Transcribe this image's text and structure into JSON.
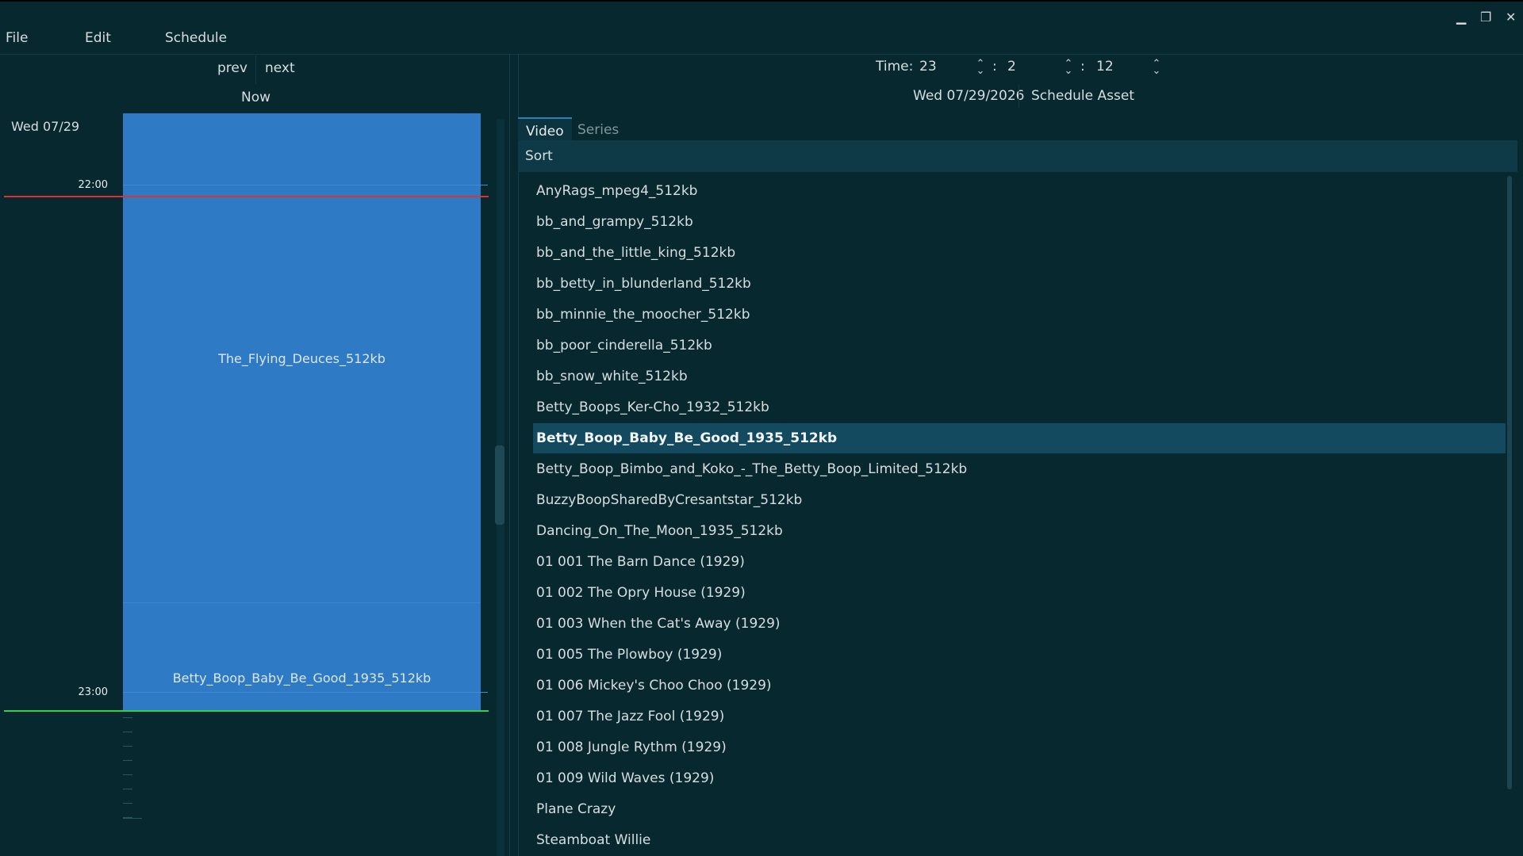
{
  "window": {
    "minimize": "▁",
    "restore": "❐",
    "close": "✕"
  },
  "menu": {
    "file": "File",
    "edit": "Edit",
    "schedule": "Schedule"
  },
  "nav": {
    "prev": "prev",
    "next": "next",
    "now": "Now"
  },
  "calendar": {
    "day_label": "Wed 07/29",
    "hours": [
      "22:00",
      "23:00"
    ],
    "events": [
      "The_Flying_Deuces_512kb",
      "Betty_Boop_Baby_Be_Good_1935_512kb"
    ]
  },
  "time": {
    "label": "Time:",
    "hour": "23",
    "minute": "2",
    "second": "12",
    "sep": ":"
  },
  "date_display": "Wed 07/29/2026",
  "schedule_button": "Schedule Asset",
  "tabs": [
    "Video",
    "Series"
  ],
  "sort_label": "Sort",
  "assets": [
    "AnyRags_mpeg4_512kb",
    "bb_and_grampy_512kb",
    "bb_and_the_little_king_512kb",
    "bb_betty_in_blunderland_512kb",
    "bb_minnie_the_moocher_512kb",
    "bb_poor_cinderella_512kb",
    "bb_snow_white_512kb",
    "Betty_Boops_Ker-Cho_1932_512kb",
    "Betty_Boop_Baby_Be_Good_1935_512kb",
    "Betty_Boop_Bimbo_and_Koko_-_The_Betty_Boop_Limited_512kb",
    "BuzzyBoopSharedByCresantstar_512kb",
    "Dancing_On_The_Moon_1935_512kb",
    "01 001 The Barn Dance (1929)",
    "01 002 The Opry House (1929)",
    "01 003 When the Cat's Away (1929)",
    "01 005 The Plowboy (1929)",
    "01 006 Mickey's Choo Choo (1929)",
    "01 007 The Jazz Fool (1929)",
    "01 008 Jungle Rythm (1929)",
    "01 009 Wild Waves (1929)",
    "Plane Crazy",
    "Steamboat Willie"
  ],
  "selected_asset": "Betty_Boop_Baby_Be_Good_1935_512kb",
  "colors": {
    "background": "#082830",
    "event": "#2e7ac4",
    "selection": "#134a60",
    "now_line_red": "#e03030",
    "now_line_green": "#2fd050"
  }
}
